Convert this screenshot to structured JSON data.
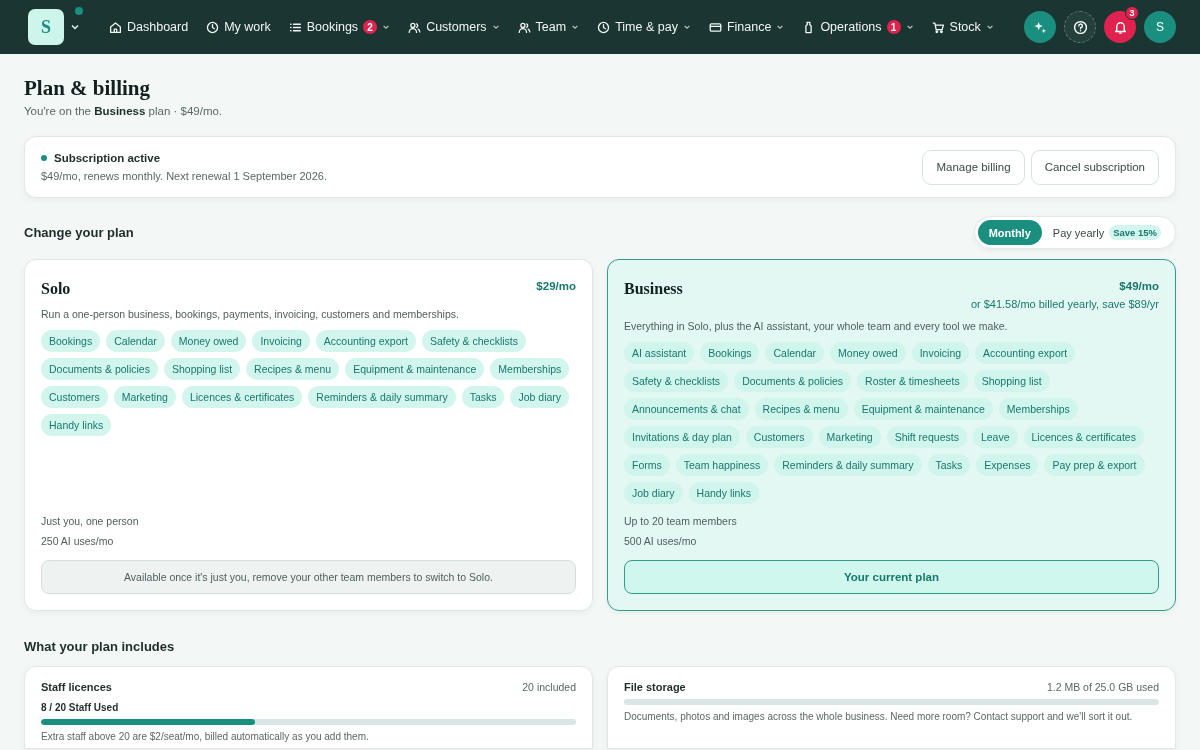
{
  "nav": {
    "logo": "S",
    "status_dot": true,
    "items": [
      {
        "label": "Dashboard",
        "dropdown": false
      },
      {
        "label": "My work",
        "dropdown": false
      },
      {
        "label": "Bookings",
        "badge": "2",
        "dropdown": true
      },
      {
        "label": "Customers",
        "dropdown": true
      },
      {
        "label": "Team",
        "dropdown": true
      },
      {
        "label": "Time & pay",
        "dropdown": true
      },
      {
        "label": "Finance",
        "dropdown": true
      },
      {
        "label": "Operations",
        "badge": "1",
        "dropdown": true
      },
      {
        "label": "Stock",
        "dropdown": true
      }
    ],
    "notifications_badge": "3",
    "avatar": "S"
  },
  "page": {
    "title": "Plan & billing",
    "subtitle": "You're on the **Business** plan · $49/mo."
  },
  "subscription": {
    "status": "Subscription active",
    "detail": "$49/mo, renews monthly. Next renewal 1 September 2026.",
    "buttons": [
      "Manage billing",
      "Cancel subscription"
    ]
  },
  "change_plan": {
    "heading": "Change your plan",
    "billing_options": [
      {
        "label": "Monthly",
        "selected": true
      },
      {
        "label": "Pay yearly",
        "badge": "Save 15%",
        "selected": false
      }
    ]
  },
  "plans": [
    {
      "name": "Solo",
      "price": "$29/mo",
      "selected": false,
      "description": "Run a one-person business, bookings, payments, invoicing, customers and memberships.",
      "features": [
        "Bookings",
        "Calendar",
        "Money owed",
        "Invoicing",
        "Accounting export",
        "Safety & checklists",
        "Documents & policies",
        "Shopping list",
        "Recipes & menu",
        "Equipment & maintenance",
        "Memberships",
        "Customers",
        "Marketing",
        "Licences & certificates",
        "Reminders & daily summary",
        "Tasks",
        "Job diary",
        "Handy links"
      ],
      "limits": [
        "Just you, one person",
        "250 AI uses/mo"
      ],
      "action": {
        "kind": "notice",
        "label": "Available once it's just you, remove your other team members to switch to Solo."
      }
    },
    {
      "name": "Business",
      "price": "$49/mo",
      "yearly_note": "or $41.58/mo billed yearly, save $89/yr",
      "selected": true,
      "description": "Everything in Solo, plus the AI assistant, your whole team and every tool we make.",
      "features": [
        "AI assistant",
        "Bookings",
        "Calendar",
        "Money owed",
        "Invoicing",
        "Accounting export",
        "Safety & checklists",
        "Documents & policies",
        "Roster & timesheets",
        "Shopping list",
        "Announcements & chat",
        "Recipes & menu",
        "Equipment & maintenance",
        "Memberships",
        "Invitations & day plan",
        "Customers",
        "Marketing",
        "Shift requests",
        "Leave",
        "Licences & certificates",
        "Forms",
        "Team happiness",
        "Reminders & daily summary",
        "Tasks",
        "Expenses",
        "Pay prep & export",
        "Job diary",
        "Handy links"
      ],
      "limits": [
        "Up to 20 team members",
        "500 AI uses/mo"
      ],
      "action": {
        "kind": "current",
        "label": "Your current plan"
      }
    }
  ],
  "includes": {
    "heading": "What your plan includes",
    "cards": [
      {
        "title": "Staff licences",
        "meta": "20 included",
        "usage": "8 / 20 Staff Used",
        "level": 0.4,
        "note": "Extra staff above 20 are $2/seat/mo, billed automatically as you add them."
      },
      {
        "title": "File storage",
        "meta": "1.2 MB of 25.0 GB used",
        "note": "Documents, photos and images across the whole business. Need more room? Contact support and we'll sort it out."
      }
    ]
  }
}
